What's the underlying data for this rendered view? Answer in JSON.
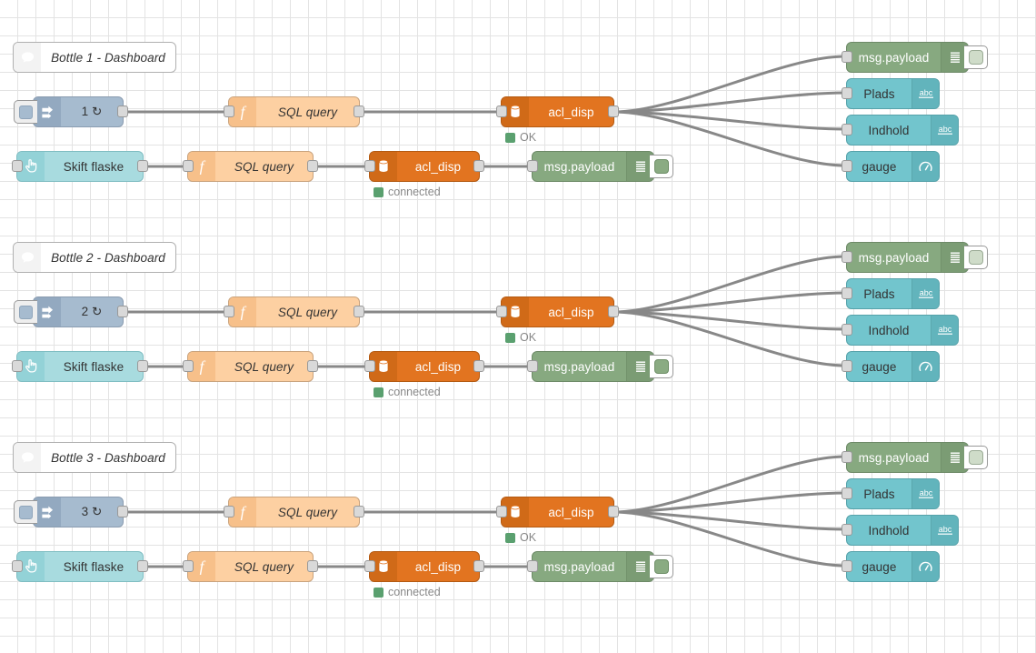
{
  "editor": {
    "app": "Node-RED flow editor",
    "grid_size_px": 20,
    "grid_color": "#e3e3e3",
    "background": "#ffffff",
    "wire_color": "#888888"
  },
  "palette": {
    "comment": "#ffffff",
    "inject": "#a6bbcf",
    "function": "#fdd0a2",
    "database": "#e27420",
    "debug": "#87a980",
    "dashboard": "#72c5cd",
    "dashboard_button": "#a8dbdf",
    "status_ok": "#5aa06f",
    "status_text": "#888888"
  },
  "flows": [
    {
      "comment": {
        "label": "Bottle 1 - Dashboard",
        "icon": "comment-icon"
      },
      "inject": {
        "label": "1 ↻",
        "icon": "inject-arrow-icon",
        "button": "inject-trigger-button"
      },
      "function_top": {
        "label": "SQL query",
        "icon": "function-f-icon"
      },
      "database_top": {
        "label": "acl_disp",
        "icon": "database-cylinder-icon",
        "status": "OK"
      },
      "ui_button": {
        "label": "Skift flaske",
        "icon": "ui-click-hand-icon"
      },
      "function_bottom": {
        "label": "SQL query",
        "icon": "function-f-icon"
      },
      "database_bottom": {
        "label": "acl_disp",
        "icon": "database-cylinder-icon",
        "status": "connected"
      },
      "debug_bottom": {
        "label": "msg.payload",
        "icon": "debug-lines-icon",
        "enabled": true
      },
      "outputs": [
        {
          "label": "msg.payload",
          "type": "debug",
          "icon": "debug-lines-icon",
          "enabled": false
        },
        {
          "label": "Plads",
          "type": "ui_text",
          "icon": "abc-text-icon"
        },
        {
          "label": "Indhold",
          "type": "ui_text",
          "icon": "abc-text-icon"
        },
        {
          "label": "gauge",
          "type": "ui_gauge",
          "icon": "gauge-dial-icon"
        }
      ]
    },
    {
      "comment": {
        "label": "Bottle 2 - Dashboard",
        "icon": "comment-icon"
      },
      "inject": {
        "label": "2 ↻",
        "icon": "inject-arrow-icon",
        "button": "inject-trigger-button"
      },
      "function_top": {
        "label": "SQL query",
        "icon": "function-f-icon"
      },
      "database_top": {
        "label": "acl_disp",
        "icon": "database-cylinder-icon",
        "status": "OK"
      },
      "ui_button": {
        "label": "Skift flaske",
        "icon": "ui-click-hand-icon"
      },
      "function_bottom": {
        "label": "SQL query",
        "icon": "function-f-icon"
      },
      "database_bottom": {
        "label": "acl_disp",
        "icon": "database-cylinder-icon",
        "status": "connected"
      },
      "debug_bottom": {
        "label": "msg.payload",
        "icon": "debug-lines-icon",
        "enabled": true
      },
      "outputs": [
        {
          "label": "msg.payload",
          "type": "debug",
          "icon": "debug-lines-icon",
          "enabled": false
        },
        {
          "label": "Plads",
          "type": "ui_text",
          "icon": "abc-text-icon"
        },
        {
          "label": "Indhold",
          "type": "ui_text",
          "icon": "abc-text-icon"
        },
        {
          "label": "gauge",
          "type": "ui_gauge",
          "icon": "gauge-dial-icon"
        }
      ]
    },
    {
      "comment": {
        "label": "Bottle 3 - Dashboard",
        "icon": "comment-icon"
      },
      "inject": {
        "label": "3 ↻",
        "icon": "inject-arrow-icon",
        "button": "inject-trigger-button"
      },
      "function_top": {
        "label": "SQL query",
        "icon": "function-f-icon"
      },
      "database_top": {
        "label": "acl_disp",
        "icon": "database-cylinder-icon",
        "status": "OK"
      },
      "ui_button": {
        "label": "Skift flaske",
        "icon": "ui-click-hand-icon"
      },
      "function_bottom": {
        "label": "SQL query",
        "icon": "function-f-icon"
      },
      "database_bottom": {
        "label": "acl_disp",
        "icon": "database-cylinder-icon",
        "status": "connected"
      },
      "debug_bottom": {
        "label": "msg.payload",
        "icon": "debug-lines-icon",
        "enabled": true
      },
      "outputs": [
        {
          "label": "msg.payload",
          "type": "debug",
          "icon": "debug-lines-icon",
          "enabled": false
        },
        {
          "label": "Plads",
          "type": "ui_text",
          "icon": "abc-text-icon"
        },
        {
          "label": "Indhold",
          "type": "ui_text",
          "icon": "abc-text-icon"
        },
        {
          "label": "gauge",
          "type": "ui_gauge",
          "icon": "gauge-dial-icon"
        }
      ]
    }
  ]
}
